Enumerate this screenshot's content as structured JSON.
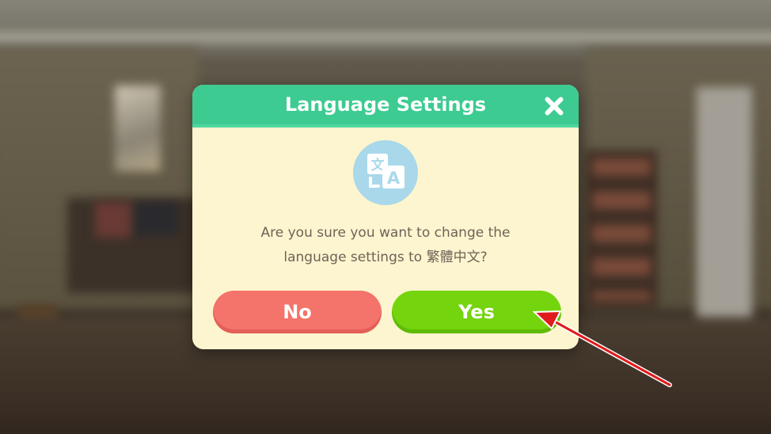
{
  "dialog": {
    "title": "Language Settings",
    "message_line1": "Are you sure you want to change the",
    "message_line2": "language settings to 繁體中文?",
    "no_label": "No",
    "yes_label": "Yes"
  },
  "icons": {
    "close": "close-icon",
    "language": "translate-icon",
    "annotation": "red-arrow"
  },
  "colors": {
    "header": "#3dcb91",
    "dialog_bg": "#fdf5cf",
    "no_button": "#f4736a",
    "yes_button": "#74d40d",
    "icon_circle": "#a9d8ea",
    "arrow": "#e01b1b"
  }
}
